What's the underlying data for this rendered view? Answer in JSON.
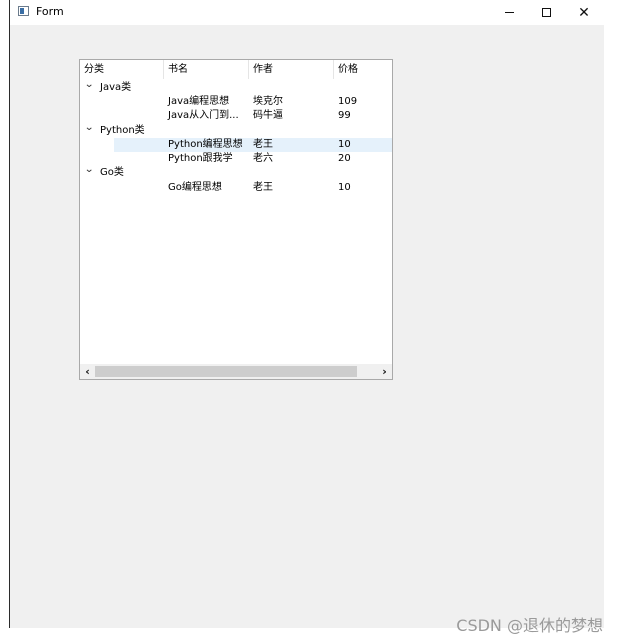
{
  "window": {
    "title": "Form"
  },
  "tree": {
    "headers": [
      "分类",
      "书名",
      "作者",
      "价格"
    ],
    "rows": [
      {
        "category": "Java类",
        "expanded": true,
        "title": "",
        "author": "",
        "price": ""
      },
      {
        "category": "",
        "title": "Java编程思想",
        "author": "埃克尔",
        "price": "109"
      },
      {
        "category": "",
        "title": "Java从入门到...",
        "author": "码牛逼",
        "price": "99"
      },
      {
        "category": "Python类",
        "expanded": true,
        "title": "",
        "author": "",
        "price": ""
      },
      {
        "category": "",
        "title": "Python编程思想",
        "author": "老王",
        "price": "10",
        "selected": true
      },
      {
        "category": "",
        "title": "Python跟我学",
        "author": "老六",
        "price": "20"
      },
      {
        "category": "Go类",
        "expanded": true,
        "title": "",
        "author": "",
        "price": ""
      },
      {
        "category": "",
        "title": "Go编程思想",
        "author": "老王",
        "price": "10"
      }
    ]
  },
  "watermark": "CSDN @退休的梦想"
}
